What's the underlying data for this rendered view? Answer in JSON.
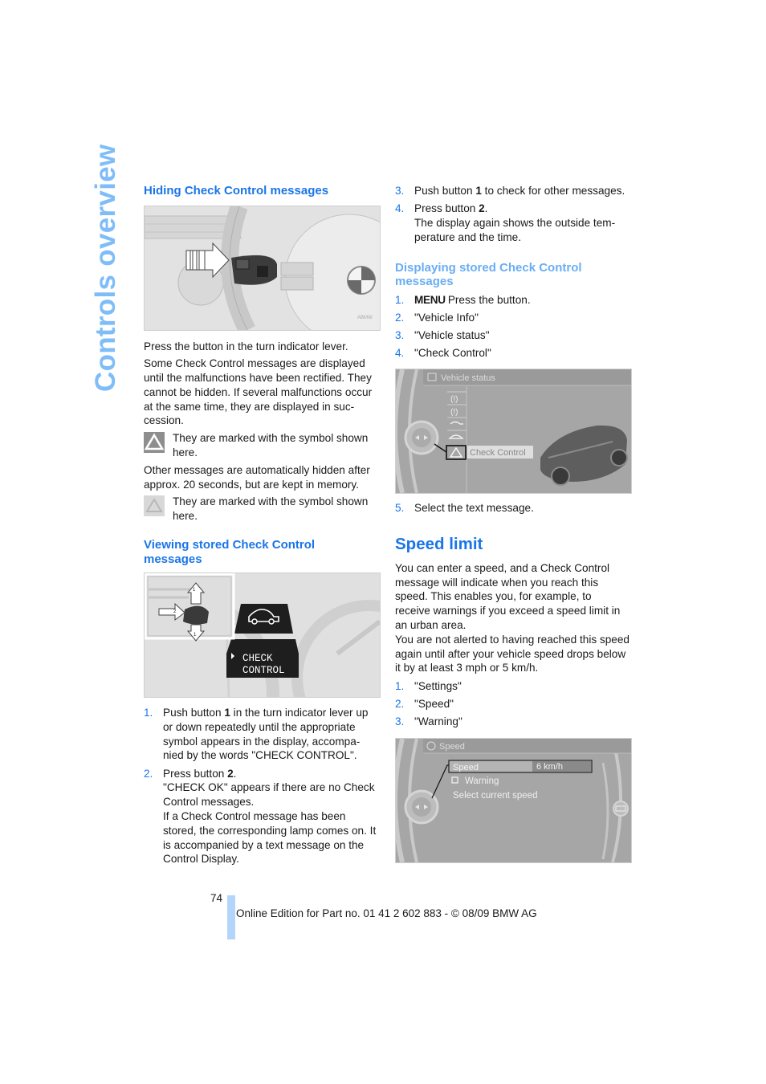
{
  "side_title": "Controls overview",
  "left": {
    "hiding": {
      "heading": "Hiding Check Control messages",
      "fig_code": "W1WZ1",
      "caption": "Press the button in the turn indicator lever.",
      "para1": "Some Check Control messages are displayed until the malfunctions have been rectified. They cannot be hidden. If several malfunctions occur at the same time, they are displayed in suc-cession.",
      "symbol1_text": "They are marked with the symbol shown here.",
      "para2": "Other messages are automatically hidden after approx. 20 seconds, but are kept in memory.",
      "symbol2_text": "They are marked with the symbol shown here."
    },
    "viewing": {
      "heading": "Viewing stored Check Control messages",
      "display_line1": "CHECK",
      "display_line2": "CONTROL",
      "steps": [
        {
          "num": "1.",
          "pre": "Push button ",
          "bold": "1",
          "post": " in the turn indicator lever up or down repeatedly until the appropriate symbol appears in the display, accompa-nied by the words \"CHECK CONTROL\"."
        },
        {
          "num": "2.",
          "pre": "Press button ",
          "bold": "2",
          "post": ".",
          "extra1": "\"CHECK OK\" appears if there are no Check Control messages.",
          "extra2": "If a Check Control message has been stored, the corresponding lamp comes on. It is accompanied by a text message on the Control Display."
        }
      ]
    }
  },
  "right": {
    "continued_steps": [
      {
        "num": "3.",
        "pre": "Push button ",
        "bold": "1",
        "post": " to check for other messages."
      },
      {
        "num": "4.",
        "pre": "Press button ",
        "bold": "2",
        "post": ".",
        "extra1": "The display again shows the outside tem-perature and the time."
      }
    ],
    "displaying": {
      "heading": "Displaying stored Check Control messages",
      "steps": [
        {
          "num": "1.",
          "menu": "MENU",
          "text": "Press the button."
        },
        {
          "num": "2.",
          "text": "\"Vehicle Info\""
        },
        {
          "num": "3.",
          "text": "\"Vehicle status\""
        },
        {
          "num": "4.",
          "text": "\"Check Control\""
        }
      ],
      "screen_title": "Vehicle status",
      "screen_selected": "Check Control",
      "step5": {
        "num": "5.",
        "text": "Select the text message."
      }
    },
    "speed_limit": {
      "heading": "Speed limit",
      "para1": "You can enter a speed, and a Check Control message will indicate when you reach this speed. This enables you, for example, to receive warnings if you exceed a speed limit in an urban area.",
      "para2": "You are not alerted to having reached this speed again until after your vehicle speed drops below it by at least 3 mph or 5 km/h.",
      "steps": [
        {
          "num": "1.",
          "text": "\"Settings\""
        },
        {
          "num": "2.",
          "text": "\"Speed\""
        },
        {
          "num": "3.",
          "text": "\"Warning\""
        }
      ],
      "screen_title": "Speed",
      "screen_row_label": "Speed",
      "screen_row_value": "6 km/h",
      "screen_option": "Warning",
      "screen_option2": "Select current speed"
    }
  },
  "footer": {
    "page_number": "74",
    "text": "Online Edition for Part no. 01 41 2 602 883 - © 08/09 BMW AG"
  }
}
